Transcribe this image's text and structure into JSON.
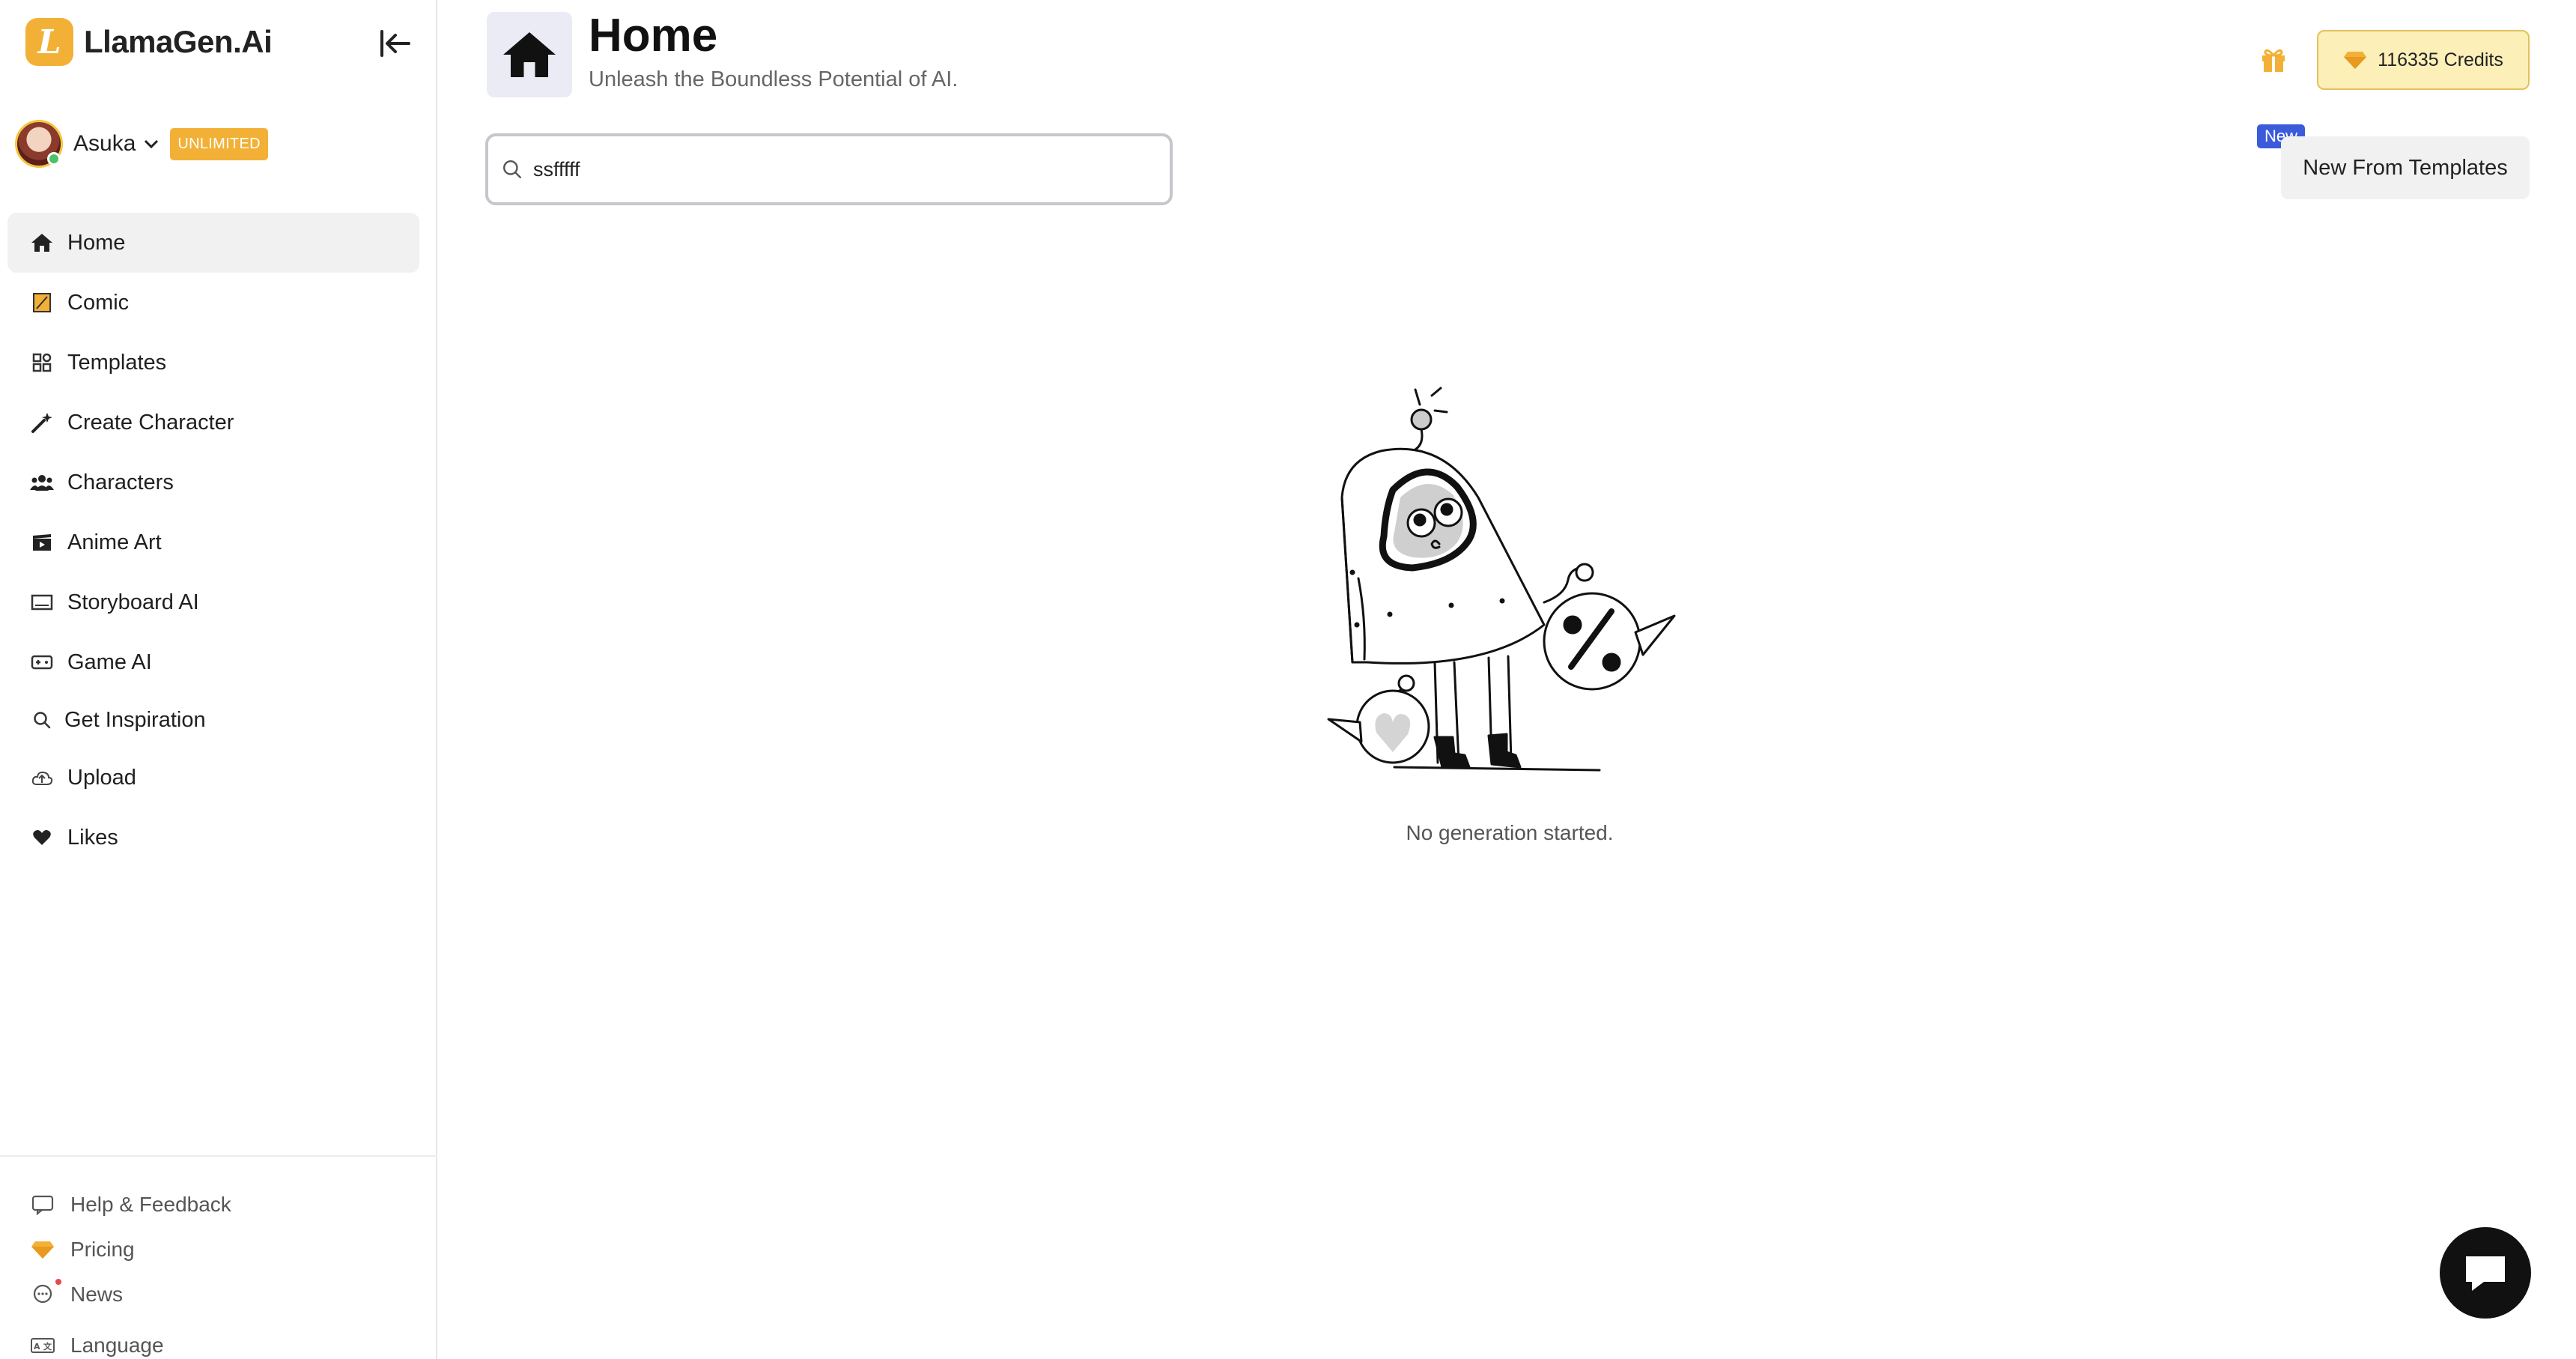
{
  "brand": {
    "logo_letter": "L",
    "name": "LlamaGen.Ai",
    "accent": "#f2b136"
  },
  "user": {
    "name": "Asuka",
    "plan_badge": "UNLIMITED"
  },
  "sidebar": {
    "items": [
      {
        "label": "Home",
        "icon": "home-icon",
        "active": true
      },
      {
        "label": "Comic",
        "icon": "comic-icon"
      },
      {
        "label": "Templates",
        "icon": "templates-icon"
      },
      {
        "label": "Create Character",
        "icon": "magic-wand-icon"
      },
      {
        "label": "Characters",
        "icon": "people-icon"
      },
      {
        "label": "Anime Art",
        "icon": "clapperboard-icon"
      },
      {
        "label": "Storyboard AI",
        "icon": "storyboard-icon"
      },
      {
        "label": "Game AI",
        "icon": "gamepad-icon"
      },
      {
        "label": "Get Inspiration",
        "icon": "search-icon"
      },
      {
        "label": "Upload",
        "icon": "upload-icon"
      },
      {
        "label": "Likes",
        "icon": "heart-icon"
      }
    ],
    "bottom": [
      {
        "label": "Help & Feedback",
        "icon": "feedback-icon"
      },
      {
        "label": "Pricing",
        "icon": "diamond-icon"
      },
      {
        "label": "News",
        "icon": "news-icon"
      },
      {
        "label": "Language",
        "icon": "language-icon"
      }
    ]
  },
  "header": {
    "title": "Home",
    "subtitle": "Unleash the Boundless Potential of AI."
  },
  "credits": {
    "label": "116335 Credits"
  },
  "search": {
    "value": "ssfffff"
  },
  "templates_button": {
    "label": "New From Templates",
    "badge": "New"
  },
  "empty_state": {
    "message": "No generation started."
  }
}
